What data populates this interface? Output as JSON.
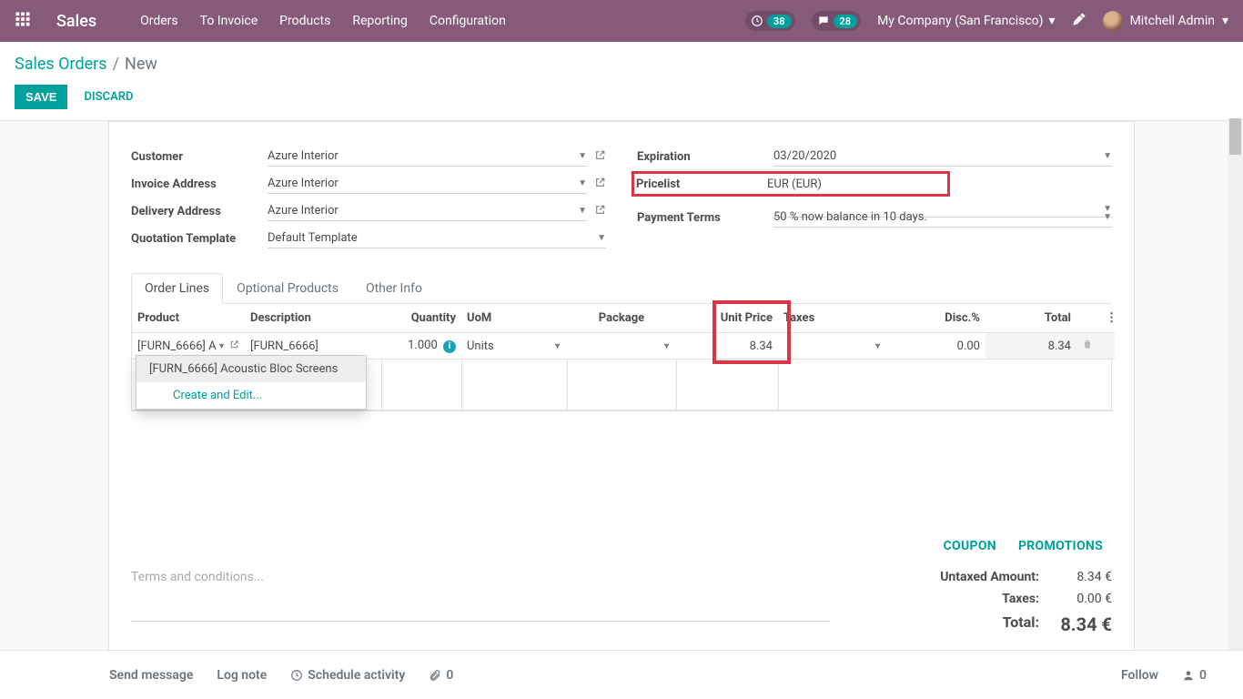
{
  "brand": "Sales",
  "nav": {
    "items": [
      "Orders",
      "To Invoice",
      "Products",
      "Reporting",
      "Configuration"
    ]
  },
  "badges": {
    "clock": "38",
    "chat": "28"
  },
  "company": "My Company (San Francisco)",
  "username": "Mitchell Admin",
  "breadcrumb": {
    "root": "Sales Orders",
    "current": "New"
  },
  "buttons": {
    "save": "SAVE",
    "discard": "DISCARD"
  },
  "left": {
    "customer": {
      "label": "Customer",
      "value": "Azure Interior"
    },
    "invoice_address": {
      "label": "Invoice Address",
      "value": "Azure Interior"
    },
    "delivery_address": {
      "label": "Delivery Address",
      "value": "Azure Interior"
    },
    "qtpl": {
      "label": "Quotation Template",
      "value": "Default Template"
    }
  },
  "right": {
    "expiration": {
      "label": "Expiration",
      "value": "03/20/2020"
    },
    "pricelist": {
      "label": "Pricelist",
      "value": "EUR (EUR)"
    },
    "terms": {
      "label": "Payment Terms",
      "value": "50 % now balance in 10 days."
    }
  },
  "tabs": {
    "order_lines": "Order Lines",
    "optional": "Optional Products",
    "other": "Other Info"
  },
  "table": {
    "headers": {
      "product": "Product",
      "description": "Description",
      "quantity": "Quantity",
      "uom": "UoM",
      "package": "Package",
      "unit_price": "Unit Price",
      "taxes": "Taxes",
      "disc": "Disc.%",
      "total": "Total"
    },
    "rows": [
      {
        "product": "[FURN_6666] A",
        "description": "[FURN_6666]",
        "quantity": "1.000",
        "uom": "Units",
        "package": "",
        "unit_price": "8.34",
        "taxes": "",
        "disc": "0.00",
        "total": "8.34"
      }
    ]
  },
  "dropdown": {
    "suggestion": "[FURN_6666] Acoustic Bloc Screens",
    "create_edit": "Create and Edit..."
  },
  "links": {
    "coupon": "COUPON",
    "promotions": "PROMOTIONS"
  },
  "terms_placeholder": "Terms and conditions...",
  "totals": {
    "untaxed": {
      "label": "Untaxed Amount:",
      "value": "8.34 €"
    },
    "taxes": {
      "label": "Taxes:",
      "value": "0.00 €"
    },
    "total": {
      "label": "Total:",
      "value": "8.34 €"
    }
  },
  "chatter": {
    "send": "Send message",
    "log": "Log note",
    "schedule": "Schedule activity",
    "attach": "0",
    "follow": "Follow",
    "followers": "0"
  }
}
